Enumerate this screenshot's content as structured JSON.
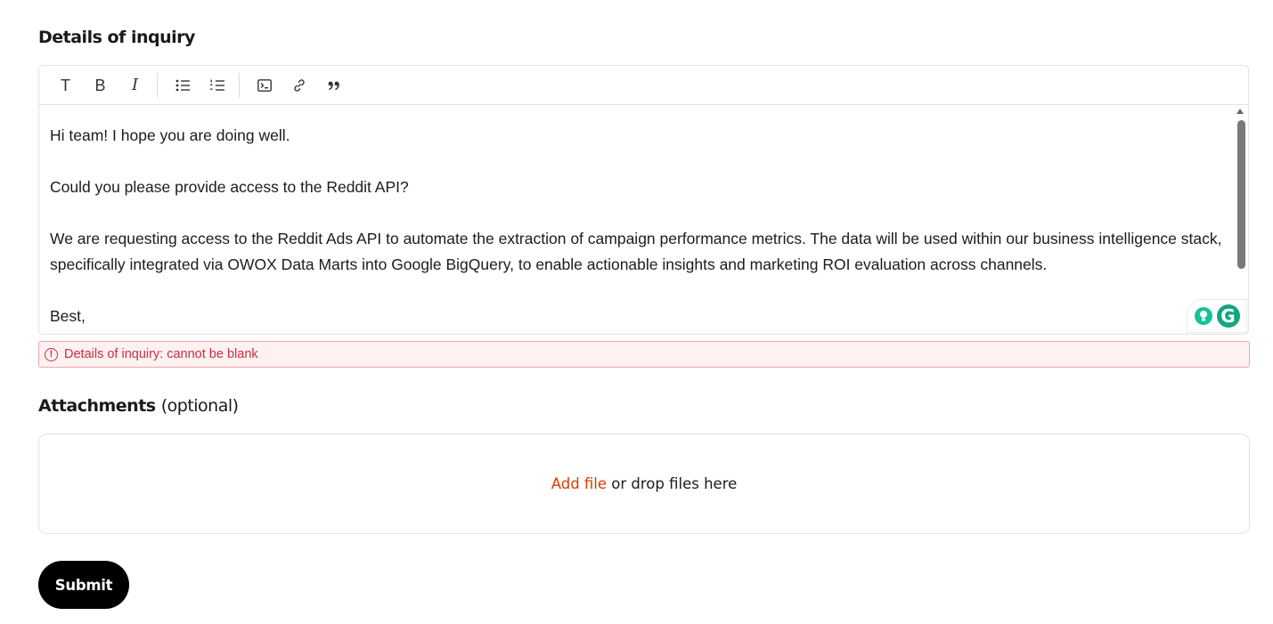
{
  "details": {
    "title": "Details of inquiry",
    "toolbar": {
      "text_label": "T",
      "bold_label": "B",
      "italic_label": "I"
    },
    "body": {
      "line1": "Hi team! I hope you are doing well.",
      "line2": "Could you please provide access to the Reddit API?",
      "line3": "We are requesting access to the Reddit Ads API to automate the extraction of campaign performance metrics. The data will be used within our business intelligence stack, specifically integrated via OWOX Data Marts into Google BigQuery, to enable actionable insights and marketing ROI evaluation across channels.",
      "line4": "Best,"
    },
    "error": "Details of inquiry: cannot be blank"
  },
  "attachments": {
    "title": "Attachments",
    "title_suffix": "(optional)",
    "add_file_label": "Add file",
    "drop_text": " or drop files here"
  },
  "submit_label": "Submit",
  "colors": {
    "accent_orange": "#d93a00",
    "error_red": "#c9303f",
    "grammarly_green": "#15c39a"
  },
  "icons": [
    "text-style-icon",
    "bold-icon",
    "italic-icon",
    "bulleted-list-icon",
    "numbered-list-icon",
    "code-block-icon",
    "link-icon",
    "quote-icon",
    "grammarly-suggestion-icon",
    "grammarly-logo-icon",
    "error-icon"
  ]
}
